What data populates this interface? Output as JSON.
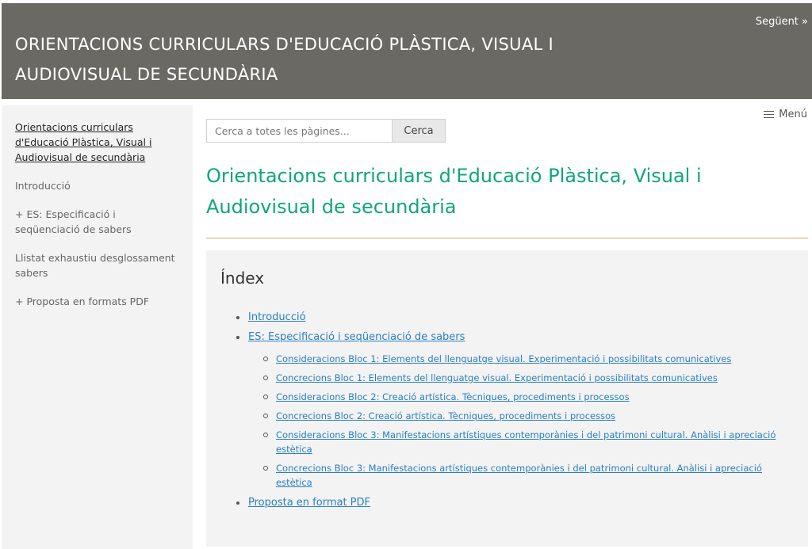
{
  "header": {
    "title": "ORIENTACIONS CURRICULARS D'EDUCACIÓ PLÀSTICA, VISUAL I AUDIOVISUAL DE SECUNDÀRIA",
    "next_label": "Següent »"
  },
  "sidebar": {
    "items": [
      {
        "label": "Orientacions curriculars d'Educació Plàstica, Visual i Audiovisual de secundària"
      },
      {
        "label": "Introducció"
      },
      {
        "label": "+ ES: Especificació i seqüenciació de sabers"
      },
      {
        "label": "Llistat exhaustiu desglossament sabers"
      },
      {
        "label": "+ Proposta en formats PDF"
      }
    ]
  },
  "menu": {
    "label": "Menú"
  },
  "search": {
    "placeholder": "Cerca a totes les pàgines...",
    "value": "",
    "button_label": "Cerca"
  },
  "main": {
    "title": "Orientacions curriculars d'Educació Plàstica, Visual i Audiovisual de secundària"
  },
  "index": {
    "title": "Índex",
    "items": [
      {
        "label": "Introducció"
      },
      {
        "label": "ES: Especificació i seqüenciació de sabers"
      },
      {
        "label": "Proposta en format PDF"
      }
    ],
    "subitems": [
      {
        "label": "Consideracions Bloc 1: Elements del llenguatge visual. Experimentació i possibilitats comunicatives"
      },
      {
        "label": "Concrecions Bloc 1: Elements del llenguatge visual. Experimentació i possibilitats comunicatives"
      },
      {
        "label": "Consideracions Bloc 2: Creació artística. Tècniques, procediments i processos"
      },
      {
        "label": "Concrecions Bloc 2: Creació artística. Tècniques, procediments i processos"
      },
      {
        "label": "Consideracions Bloc 3: Manifestacions artístiques contemporànies i del patrimoni cultural. Anàlisi i apreciació estètica"
      },
      {
        "label": "Concrecions Bloc 3: Manifestacions artístiques contemporànies i del patrimoni cultural. Anàlisi i apreciació estètica"
      }
    ]
  },
  "colors": {
    "header_bg": "#6b6964",
    "title_green": "#0fa67a",
    "divider_orange": "#e99b6a",
    "link_blue": "#2a7fc1"
  }
}
